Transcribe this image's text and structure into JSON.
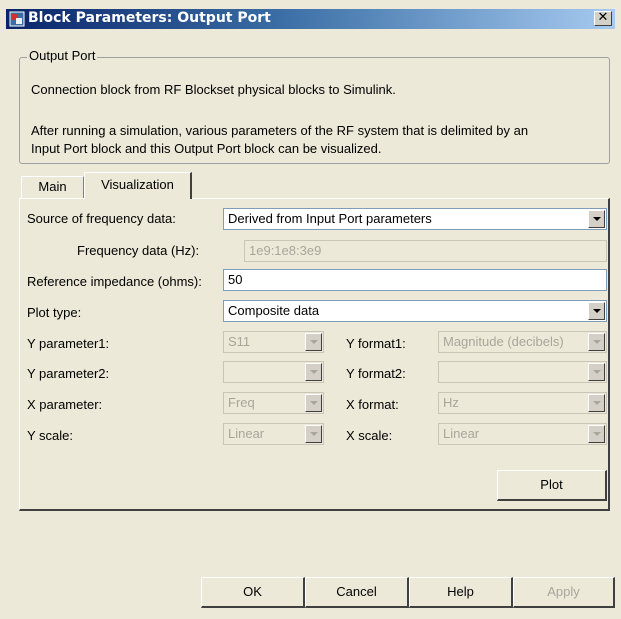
{
  "window": {
    "title": "Block Parameters: Output Port",
    "close_glyph": "✕"
  },
  "group": {
    "legend": "Output Port",
    "description_line1": "Connection block from RF Blockset physical blocks to Simulink.",
    "description_line2a": "After running a simulation, various parameters of the RF system that is delimited by an",
    "description_line2b": "Input Port block and this Output Port block can be visualized."
  },
  "tabs": [
    {
      "label": "Main",
      "selected": false
    },
    {
      "label": "Visualization",
      "selected": true
    }
  ],
  "form": {
    "source_label": "Source of frequency data:",
    "source_value": "Derived from Input Port parameters",
    "freq_label": "Frequency data (Hz):",
    "freq_value": "1e9:1e8:3e9",
    "ref_label": "Reference impedance (ohms):",
    "ref_value": "50",
    "plot_type_label": "Plot type:",
    "plot_type_value": "Composite data",
    "y_param1_label": "Y parameter1:",
    "y_param1_value": "S11",
    "y_format1_label": "Y format1:",
    "y_format1_value": "Magnitude (decibels)",
    "y_param2_label": "Y parameter2:",
    "y_param2_value": "",
    "y_format2_label": "Y format2:",
    "y_format2_value": "",
    "x_param_label": "X parameter:",
    "x_param_value": "Freq",
    "x_format_label": "X format:",
    "x_format_value": "Hz",
    "y_scale_label": "Y scale:",
    "y_scale_value": "Linear",
    "x_scale_label": "X scale:",
    "x_scale_value": "Linear",
    "plot_button": "Plot"
  },
  "footer": {
    "ok": "OK",
    "cancel": "Cancel",
    "help": "Help",
    "apply": "Apply"
  }
}
